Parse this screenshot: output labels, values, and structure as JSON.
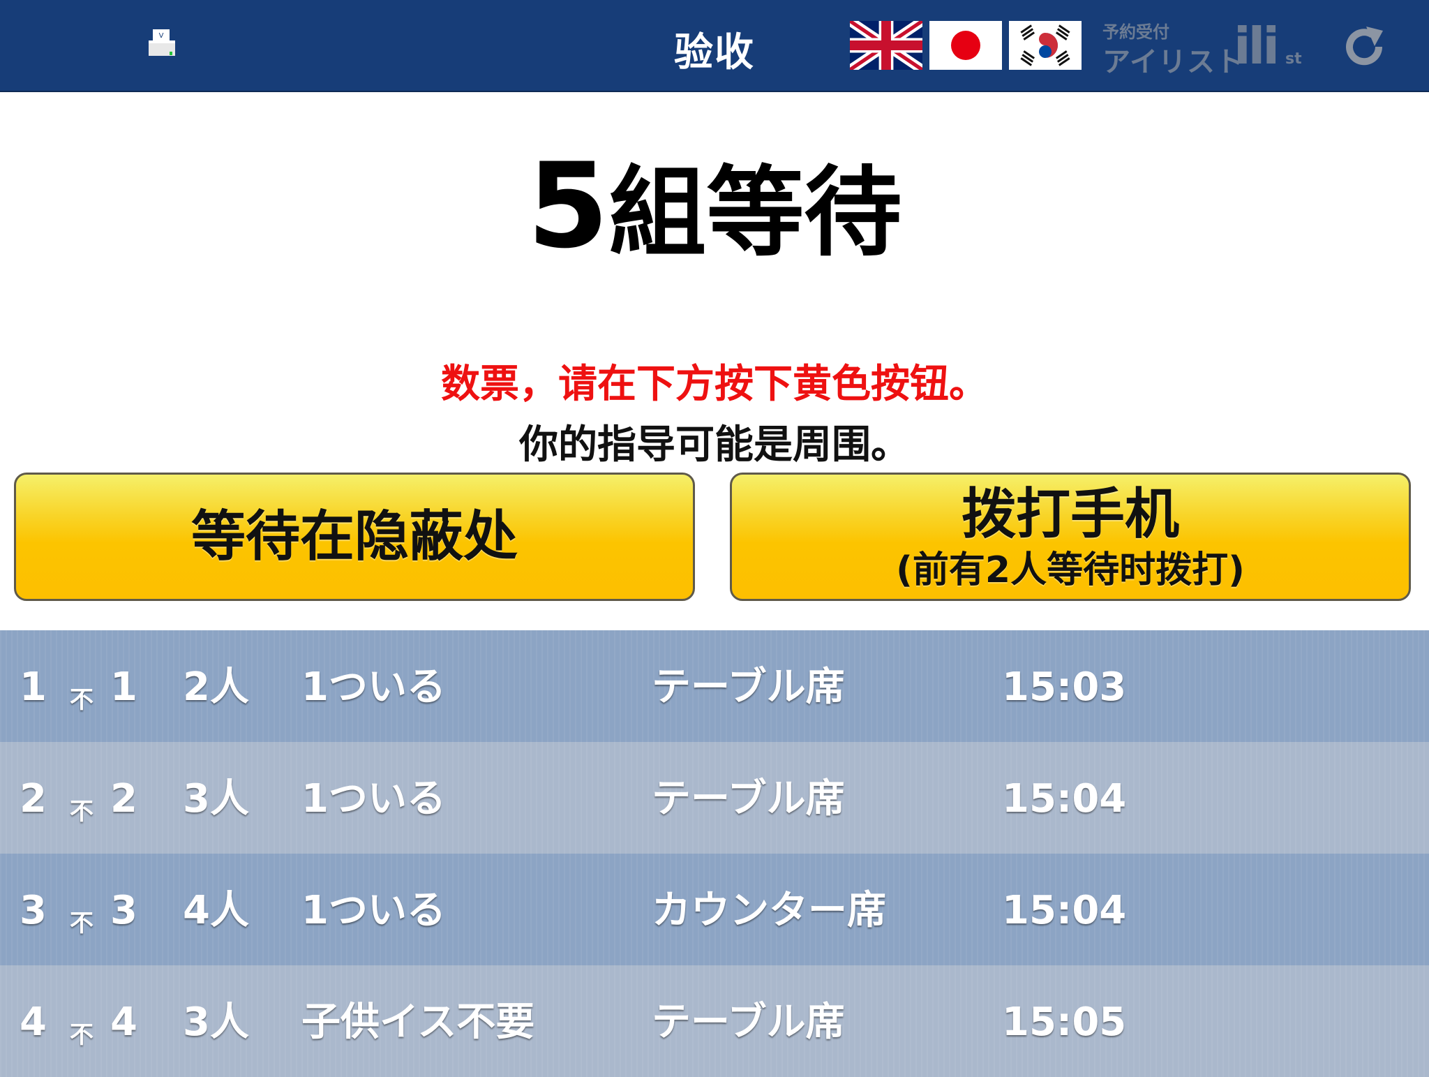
{
  "header": {
    "title": "验收",
    "brand_small": "予約受付",
    "brand_big": "アイリスト",
    "brand_logo": "ili",
    "brand_logo_sub": "st"
  },
  "status": {
    "count": "5",
    "count_suffix": "組等待",
    "notice_red": "数票，请在下方按下黄色按钮。",
    "notice_black": "你的指导可能是周围。"
  },
  "buttons": {
    "wait_label": "等待在隐蔽处",
    "call_label": "拨打手机",
    "call_sub": "(前有2人等待时拨打)"
  },
  "queue": [
    {
      "idx": "1",
      "prefix": "不",
      "num": "1",
      "people": "2人",
      "note": "1ついる",
      "seat": "テーブル席",
      "time": "15:03"
    },
    {
      "idx": "2",
      "prefix": "不",
      "num": "2",
      "people": "3人",
      "note": "1ついる",
      "seat": "テーブル席",
      "time": "15:04"
    },
    {
      "idx": "3",
      "prefix": "不",
      "num": "3",
      "people": "4人",
      "note": "1ついる",
      "seat": "カウンター席",
      "time": "15:04"
    },
    {
      "idx": "4",
      "prefix": "不",
      "num": "4",
      "people": "3人",
      "note": "子供イス不要",
      "seat": "テーブル席",
      "time": "15:05"
    }
  ],
  "colors": {
    "header_bg": "#173d78",
    "notice_red": "#ee1111",
    "button_yellow": "#fdbf00",
    "row_odd": "#8ca4c4",
    "row_even": "#aab8cc"
  },
  "icons": [
    "printer-icon",
    "flag-uk-icon",
    "flag-japan-icon",
    "flag-korea-icon",
    "refresh-icon"
  ]
}
